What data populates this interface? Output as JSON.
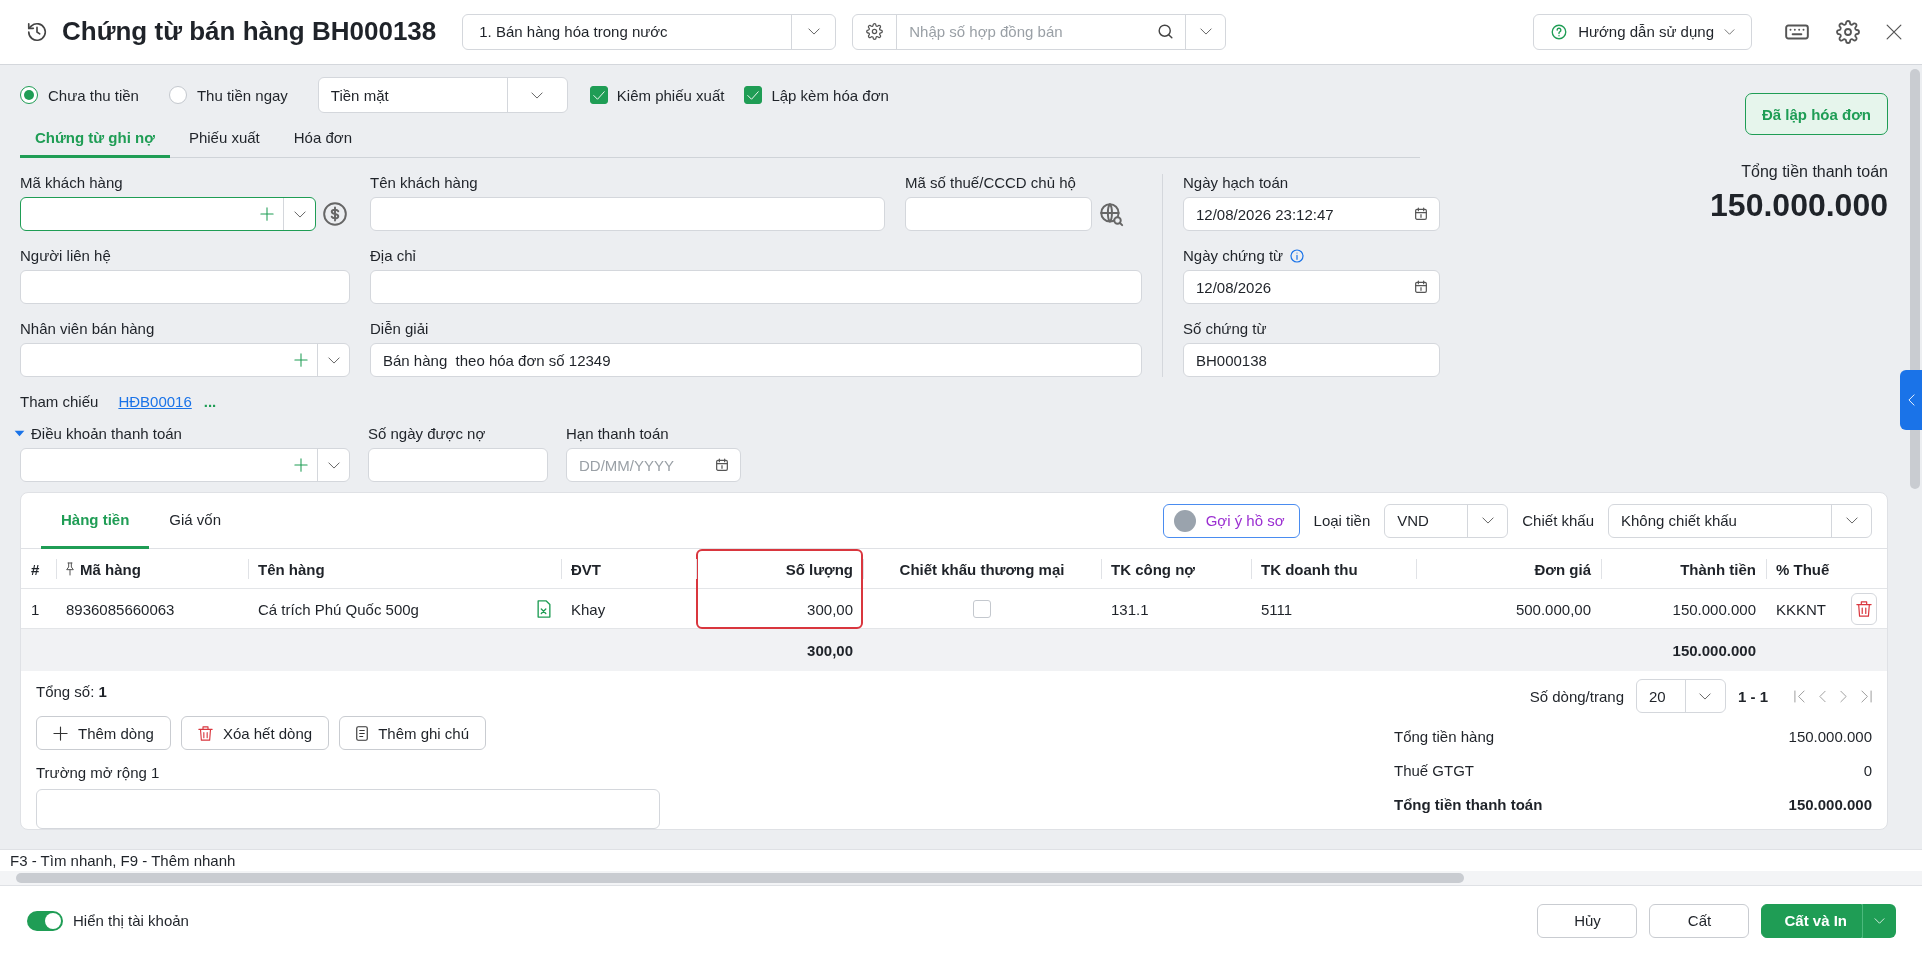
{
  "header": {
    "title": "Chứng từ bán hàng BH000138",
    "voucher_type": "1. Bán hàng hóa trong nước",
    "contract_search": {
      "placeholder": "Nhập số hợp đồng bán"
    },
    "help": "Hướng dẫn sử dụng"
  },
  "payment": {
    "options": [
      {
        "label": "Chưa thu tiền",
        "selected": true
      },
      {
        "label": "Thu tiền ngay",
        "selected": false
      }
    ],
    "method": "Tiền mặt",
    "checks": [
      {
        "label": "Kiêm phiếu xuất",
        "checked": true
      },
      {
        "label": "Lập kèm hóa đơn",
        "checked": true
      }
    ]
  },
  "tabs": [
    {
      "label": "Chứng từ ghi nợ",
      "selected": true
    },
    {
      "label": "Phiếu xuất",
      "selected": false
    },
    {
      "label": "Hóa đơn",
      "selected": false
    }
  ],
  "invoice_status": "Đã lập hóa đơn",
  "total": {
    "label": "Tổng tiền thanh toán",
    "value": "150.000.000"
  },
  "fields": {
    "customer_code": {
      "label": "Mã khách hàng"
    },
    "customer_name": {
      "label": "Tên khách hàng"
    },
    "tax_id": {
      "label": "Mã số thuế/CCCD chủ hộ"
    },
    "posting_date": {
      "label": "Ngày hạch toán",
      "value": "12/08/2026 23:12:47"
    },
    "contact": {
      "label": "Người liên hệ"
    },
    "address": {
      "label": "Địa chỉ"
    },
    "voucher_date": {
      "label": "Ngày chứng từ",
      "value": "12/08/2026"
    },
    "salesperson": {
      "label": "Nhân viên bán hàng"
    },
    "description": {
      "label": "Diễn giải",
      "value": "Bán hàng  theo hóa đơn số 12349"
    },
    "voucher_no": {
      "label": "Số chứng từ",
      "value": "BH000138"
    }
  },
  "reference": {
    "label": "Tham chiếu",
    "link": "HĐB00016",
    "more": "..."
  },
  "payment_terms": {
    "label": "Điều khoản thanh toán",
    "expanded": true
  },
  "credit_days": {
    "label": "Số ngày được nợ"
  },
  "due_date": {
    "label": "Hạn thanh toán",
    "placeholder": "DD/MM/YYYY"
  },
  "detail": {
    "tabs": [
      {
        "label": "Hàng tiền",
        "selected": true
      },
      {
        "label": "Giá vốn",
        "selected": false
      }
    ],
    "suggest": "Gợi ý hồ sơ",
    "currency": {
      "label": "Loại tiền",
      "value": "VND"
    },
    "discount": {
      "label": "Chiết khấu",
      "value": "Không chiết khấu"
    },
    "columns": [
      {
        "label": "#",
        "kind": "text"
      },
      {
        "label": "Mã hàng",
        "kind": "pinned"
      },
      {
        "label": "Tên hàng",
        "kind": "name"
      },
      {
        "label": "ĐVT",
        "kind": "text"
      },
      {
        "label": "Số lượng",
        "kind": "number",
        "highlighted": true
      },
      {
        "label": "Chiết khấu thương mại",
        "kind": "check"
      },
      {
        "label": "TK công nợ",
        "kind": "text"
      },
      {
        "label": "TK doanh thu",
        "kind": "text"
      },
      {
        "label": "Đơn giá",
        "kind": "number"
      },
      {
        "label": "Thành tiền",
        "kind": "number"
      },
      {
        "label": "% Thuế",
        "kind": "text"
      }
    ],
    "rows": [
      {
        "cells": [
          "1",
          "8936085660063",
          "Cá trích Phú Quốc 500g",
          "Khay",
          "300,00",
          false,
          "131.1",
          "5111",
          "500.000,00",
          "150.000.000",
          "KKKNT"
        ]
      }
    ],
    "totals": {
      "quantity": "300,00",
      "amount": "150.000.000"
    },
    "count_label": "Tổng số:",
    "count": "1",
    "page_size": {
      "label": "Số dòng/trang",
      "value": "20"
    },
    "range": "1 - 1",
    "actions": [
      {
        "label": "Thêm dòng",
        "kind": "add"
      },
      {
        "label": "Xóa hết dòng",
        "kind": "delete"
      },
      {
        "label": "Thêm ghi chú",
        "kind": "note"
      }
    ],
    "extra_field": {
      "label": "Trường mở rộng 1"
    },
    "summary": [
      {
        "label": "Tổng tiền hàng",
        "value": "150.000.000",
        "bold": false
      },
      {
        "label": "Thuế GTGT",
        "value": "0",
        "bold": false
      },
      {
        "label": "Tổng tiền thanh toán",
        "value": "150.000.000",
        "bold": true
      }
    ]
  },
  "hint": "F3 - Tìm nhanh, F9 - Thêm nhanh",
  "footer": {
    "toggle": {
      "label": "Hiển thị tài khoản",
      "on": true
    },
    "buttons": [
      {
        "label": "Hủy",
        "kind": "default"
      },
      {
        "label": "Cất",
        "kind": "default"
      },
      {
        "label": "Cất và In",
        "kind": "primary"
      }
    ]
  }
}
